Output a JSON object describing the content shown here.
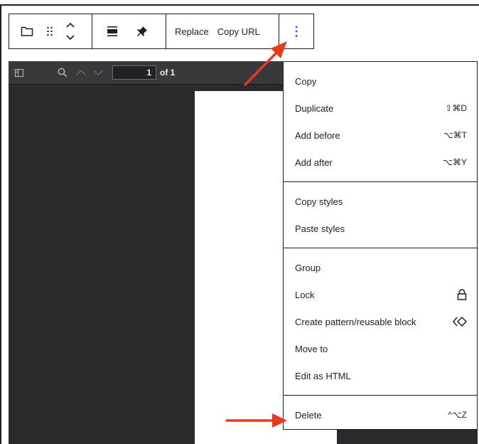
{
  "toolbar": {
    "replace_label": "Replace",
    "copy_url_label": "Copy URL",
    "options_icon": "⋮"
  },
  "pdf_viewer": {
    "page_number": "1",
    "page_of": "of 1",
    "background_color": "#2a2a2e"
  },
  "menu": {
    "sections": [
      [
        {
          "label": "Copy",
          "shortcut": ""
        },
        {
          "label": "Duplicate",
          "shortcut": "⇧⌘D"
        },
        {
          "label": "Add before",
          "shortcut": "⌥⌘T"
        },
        {
          "label": "Add after",
          "shortcut": "⌥⌘Y"
        }
      ],
      [
        {
          "label": "Copy styles",
          "shortcut": ""
        },
        {
          "label": "Paste styles",
          "shortcut": ""
        }
      ],
      [
        {
          "label": "Group",
          "shortcut": ""
        },
        {
          "label": "Lock",
          "icon": "lock-icon"
        },
        {
          "label": "Create pattern/reusable block",
          "icon": "pattern-icon"
        },
        {
          "label": "Move to",
          "shortcut": ""
        },
        {
          "label": "Edit as HTML",
          "shortcut": ""
        }
      ],
      [
        {
          "label": "Delete",
          "shortcut": "^⌥Z"
        }
      ]
    ]
  },
  "colors": {
    "accent": "#3858e9",
    "arrow": "#e8391c"
  }
}
